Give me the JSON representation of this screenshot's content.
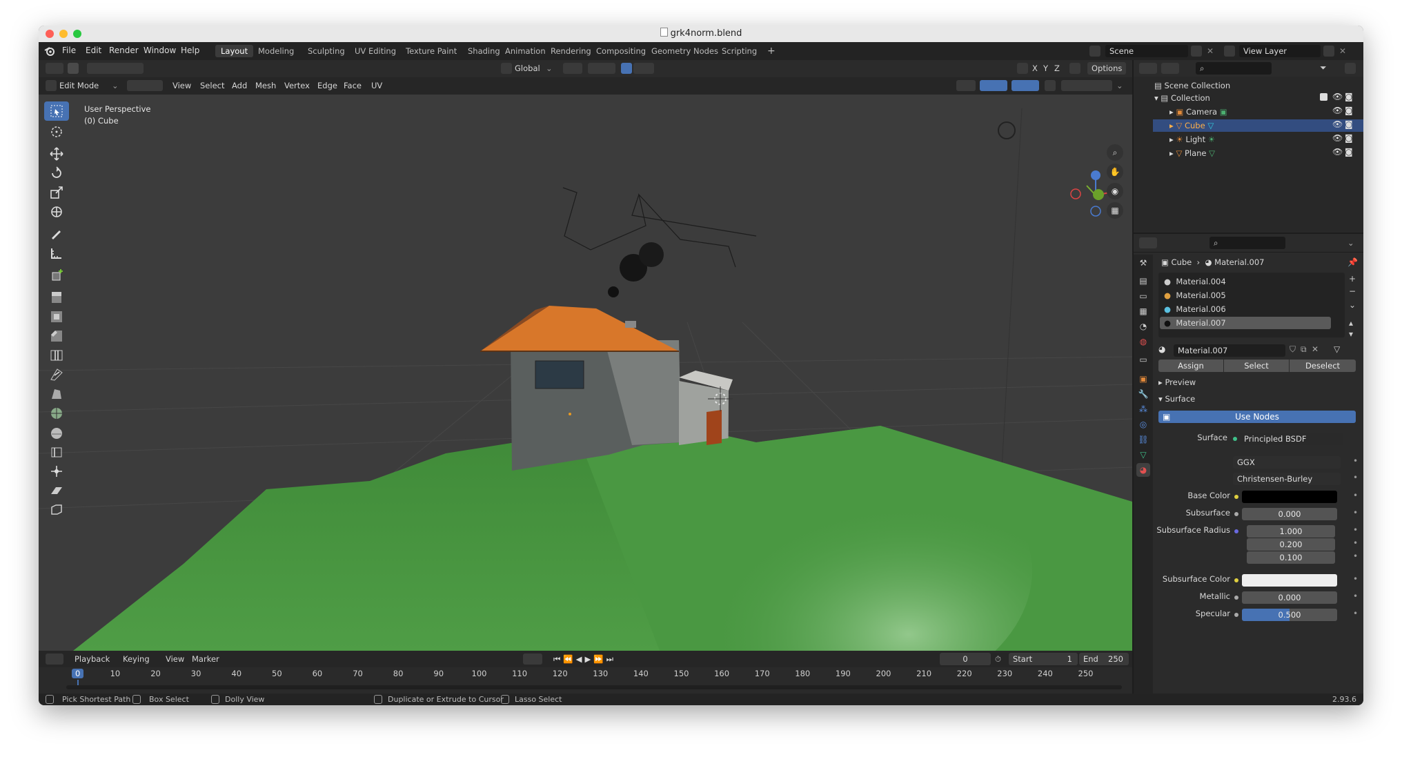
{
  "window": {
    "title": "grk4norm.blend"
  },
  "menu": [
    "File",
    "Edit",
    "Render",
    "Window",
    "Help"
  ],
  "workspaces": [
    "Layout",
    "Modeling",
    "Sculpting",
    "UV Editing",
    "Texture Paint",
    "Shading",
    "Animation",
    "Rendering",
    "Compositing",
    "Geometry Nodes",
    "Scripting"
  ],
  "active_workspace": "Layout",
  "scene": {
    "label": "Scene",
    "view_layer": "View Layer"
  },
  "viewport_header": {
    "orientation": "Global",
    "options": "Options",
    "axes": [
      "X",
      "Y",
      "Z"
    ],
    "mode": "Edit Mode",
    "menus": [
      "View",
      "Select",
      "Add",
      "Mesh",
      "Vertex",
      "Edge",
      "Face",
      "UV"
    ]
  },
  "viewport": {
    "perspective": "User Perspective",
    "object": "(0) Cube"
  },
  "outliner": {
    "root": "Scene Collection",
    "collection": "Collection",
    "items": [
      "Camera",
      "Cube",
      "Light",
      "Plane"
    ],
    "selected": "Cube"
  },
  "properties": {
    "breadcrumb_object": "Cube",
    "breadcrumb_material": "Material.007",
    "materials": [
      "Material.004",
      "Material.005",
      "Material.006",
      "Material.007"
    ],
    "active_material": "Material.007",
    "slot_name": "Material.007",
    "buttons": {
      "assign": "Assign",
      "select": "Select",
      "deselect": "Deselect"
    },
    "panels": {
      "preview": "Preview",
      "surface": "Surface"
    },
    "use_nodes": "Use Nodes",
    "fields": {
      "surface_label": "Surface",
      "surface_value": "Principled BSDF",
      "distribution": "GGX",
      "subsurface_method": "Christensen-Burley",
      "base_color_label": "Base Color",
      "subsurface_label": "Subsurface",
      "subsurface_value": "0.000",
      "subsurface_radius_label": "Subsurface Radius",
      "radius": [
        "1.000",
        "0.200",
        "0.100"
      ],
      "subsurface_color_label": "Subsurface Color",
      "metallic_label": "Metallic",
      "metallic_value": "0.000",
      "specular_label": "Specular",
      "specular_value": "0.500"
    },
    "colors": {
      "base_color": "#000000",
      "subsurface_color": "#eeeeee",
      "accent": "#4772b3"
    }
  },
  "timeline": {
    "menus": [
      "Playback",
      "Keying",
      "View",
      "Marker"
    ],
    "current_frame": "0",
    "start_label": "Start",
    "start": "1",
    "end_label": "End",
    "end": "250",
    "ticks": [
      "0",
      "10",
      "20",
      "30",
      "40",
      "50",
      "60",
      "70",
      "80",
      "90",
      "100",
      "110",
      "120",
      "130",
      "140",
      "150",
      "160",
      "170",
      "180",
      "190",
      "200",
      "210",
      "220",
      "230",
      "240",
      "250"
    ]
  },
  "status": {
    "items": [
      "Pick Shortest Path",
      "Box Select",
      "Dolly View",
      "Duplicate or Extrude to Cursor",
      "Lasso Select"
    ],
    "version": "2.93.6"
  }
}
